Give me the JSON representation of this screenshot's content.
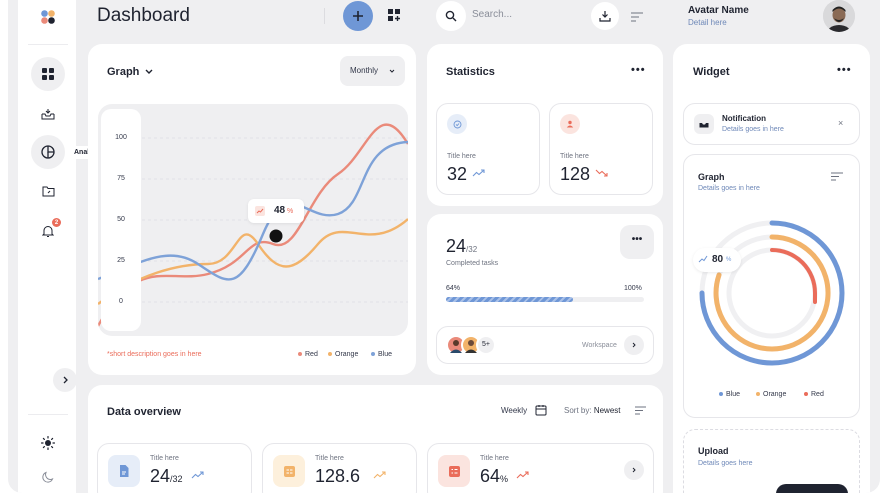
{
  "header": {
    "title": "Dashboard",
    "search_placeholder": "Search...",
    "user_name": "Avatar Name",
    "user_detail": "Detail here"
  },
  "sidebar": {
    "tooltip": "Analytics",
    "notification_count": "2"
  },
  "graph_card": {
    "title": "Graph",
    "period_label": "Monthly",
    "y_ticks": [
      "100",
      "75",
      "50",
      "25",
      "0"
    ],
    "tooltip_value": "48",
    "tooltip_unit": "%",
    "description": "*short description goes in here",
    "legend": [
      "Red",
      "Orange",
      "Blue"
    ]
  },
  "chart_data": {
    "type": "line",
    "y_ticks": [
      100,
      75,
      50,
      25,
      0
    ],
    "ylim": [
      0,
      100
    ],
    "highlight_value": 48,
    "highlight_unit": "%",
    "legend_placement": "bottom-right",
    "grid": true,
    "series": [
      {
        "name": "Red",
        "color": "#ea8a7a"
      },
      {
        "name": "Orange",
        "color": "#f2b36a"
      },
      {
        "name": "Blue",
        "color": "#7ea2d8"
      }
    ]
  },
  "statistics": {
    "title": "Statistics",
    "items": [
      {
        "label": "Title here",
        "value": "32",
        "trend": "up"
      },
      {
        "label": "Title here",
        "value": "128",
        "trend": "down"
      }
    ]
  },
  "tasks": {
    "done": "24",
    "total": "/32",
    "label": "Completed tasks",
    "progress_label": "64%",
    "progress_max": "100%",
    "progress": 0.64,
    "members_more": "5+",
    "workspace_label": "Workspace"
  },
  "widget": {
    "title": "Widget",
    "notification_title": "Notification",
    "notification_detail": "Details goes in here",
    "graph_title": "Graph",
    "graph_detail": "Details goes in here",
    "donut_value": "80",
    "donut_unit": "%",
    "legend": [
      "Blue",
      "Orange",
      "Red"
    ],
    "upload_title": "Upload",
    "upload_detail": "Details goes here"
  },
  "data_overview": {
    "title": "Data overview",
    "period_label": "Weekly",
    "sort_label": "Sort by:",
    "sort_value": "Newest",
    "items": [
      {
        "label": "Title here",
        "value": "24",
        "suffix": "/32",
        "color": "#6f97d6"
      },
      {
        "label": "Title here",
        "value": "128.6",
        "suffix": "",
        "color": "#f2b36a"
      },
      {
        "label": "Title here",
        "value": "64",
        "suffix": "%",
        "color": "#ea6c5a"
      }
    ]
  },
  "colors": {
    "blue": "#6f97d6",
    "orange": "#f2b36a",
    "red": "#ea8a7a",
    "background": "#efeff1"
  }
}
